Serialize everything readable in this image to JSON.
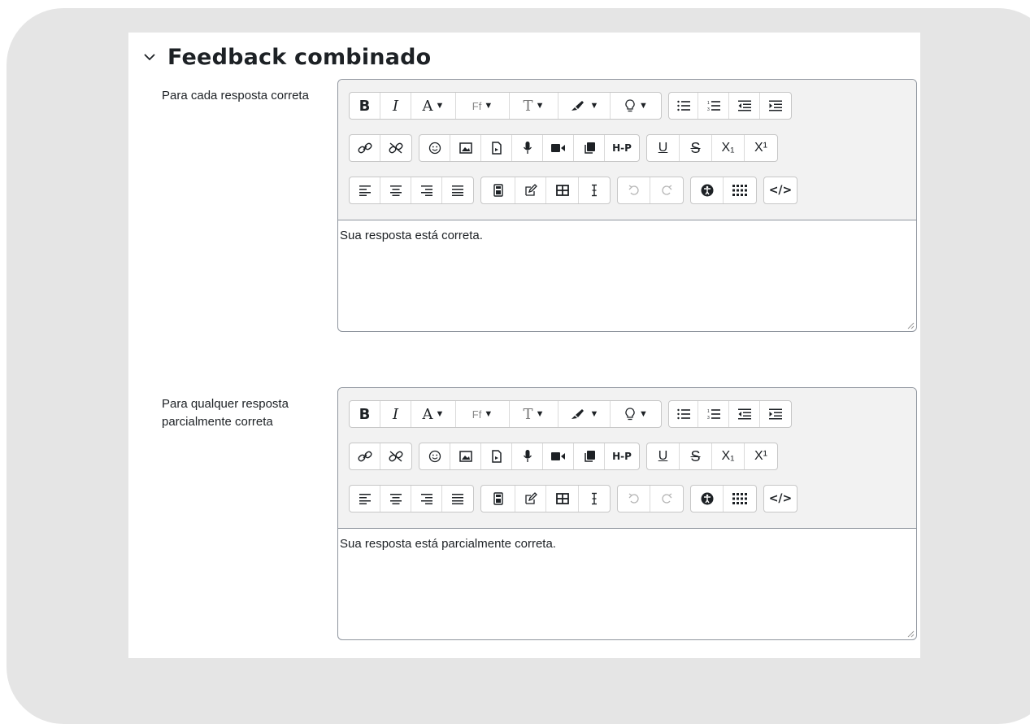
{
  "section": {
    "title": "Feedback combinado",
    "chevron_icon": "chevron-down-icon"
  },
  "fields": [
    {
      "label": "Para cada resposta correta",
      "content": "Sua resposta está correta."
    },
    {
      "label": "Para qualquer resposta parcialmente correta",
      "content": "Sua resposta está parcialmente correta."
    }
  ],
  "toolbar": {
    "bold": "B",
    "italic": "I",
    "font_color": "A",
    "font_family": "Ff",
    "font_size": "T",
    "h5p": "H-P",
    "subscript": "X₁",
    "superscript": "X¹",
    "html": "</>"
  },
  "colors": {
    "frame": "#e5e5e5",
    "border": "#8f959e",
    "toolbar_bg": "#f2f2f2",
    "text": "#1d2125",
    "disabled": "#b5b5b5"
  }
}
